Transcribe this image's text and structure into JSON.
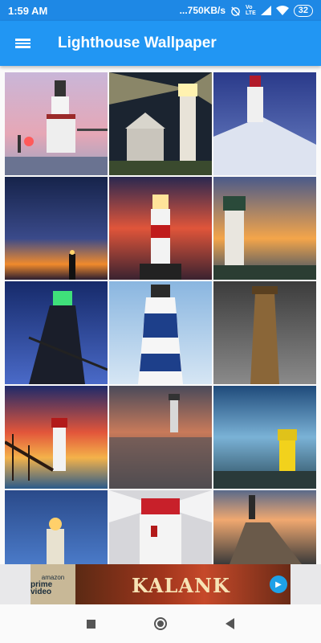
{
  "status_bar": {
    "time": "1:59 AM",
    "indicators": "...750KB/s",
    "network_label_top": "Vo",
    "network_label_bottom": "LTE",
    "battery": "32",
    "icons": [
      "alarm-off-icon",
      "signal-icon",
      "wifi-icon",
      "battery-icon"
    ]
  },
  "app_bar": {
    "title": "Lighthouse Wallpaper",
    "menu_icon": "hamburger-menu-icon"
  },
  "gallery": {
    "tiles": [
      {
        "description": "white lighthouse on pier at pink sunset"
      },
      {
        "description": "lighthouse beam at night with house"
      },
      {
        "description": "lighthouse on rocky cliff at dusk"
      },
      {
        "description": "lighthouse silhouette under starry orange sky"
      },
      {
        "description": "red and white lighthouse at sunset"
      },
      {
        "description": "white lighthouse on coastal cliff"
      },
      {
        "description": "dark pierhead lighthouse with green light"
      },
      {
        "description": "blue and white striped lighthouse"
      },
      {
        "description": "brown wooden lighthouse tower"
      },
      {
        "description": "pier and lighthouse at fiery sunset"
      },
      {
        "description": "lighthouse in calm water at dusk"
      },
      {
        "description": "yellow lighthouse under blue sky"
      },
      {
        "description": "glowing lighthouse at night"
      },
      {
        "description": "red lighthouse top with light rays"
      },
      {
        "description": "wooden pier with lighthouse at sunset"
      }
    ]
  },
  "ad_banner": {
    "sponsor_line1": "amazon",
    "sponsor_line2": "prime video",
    "movie_title": "KALANK",
    "play_icon": "play-icon"
  },
  "nav_bar": {
    "icons": [
      "recents-icon",
      "home-icon",
      "back-icon"
    ]
  },
  "colors": {
    "status_bar": "#1e88e5",
    "app_bar": "#2196f3"
  }
}
